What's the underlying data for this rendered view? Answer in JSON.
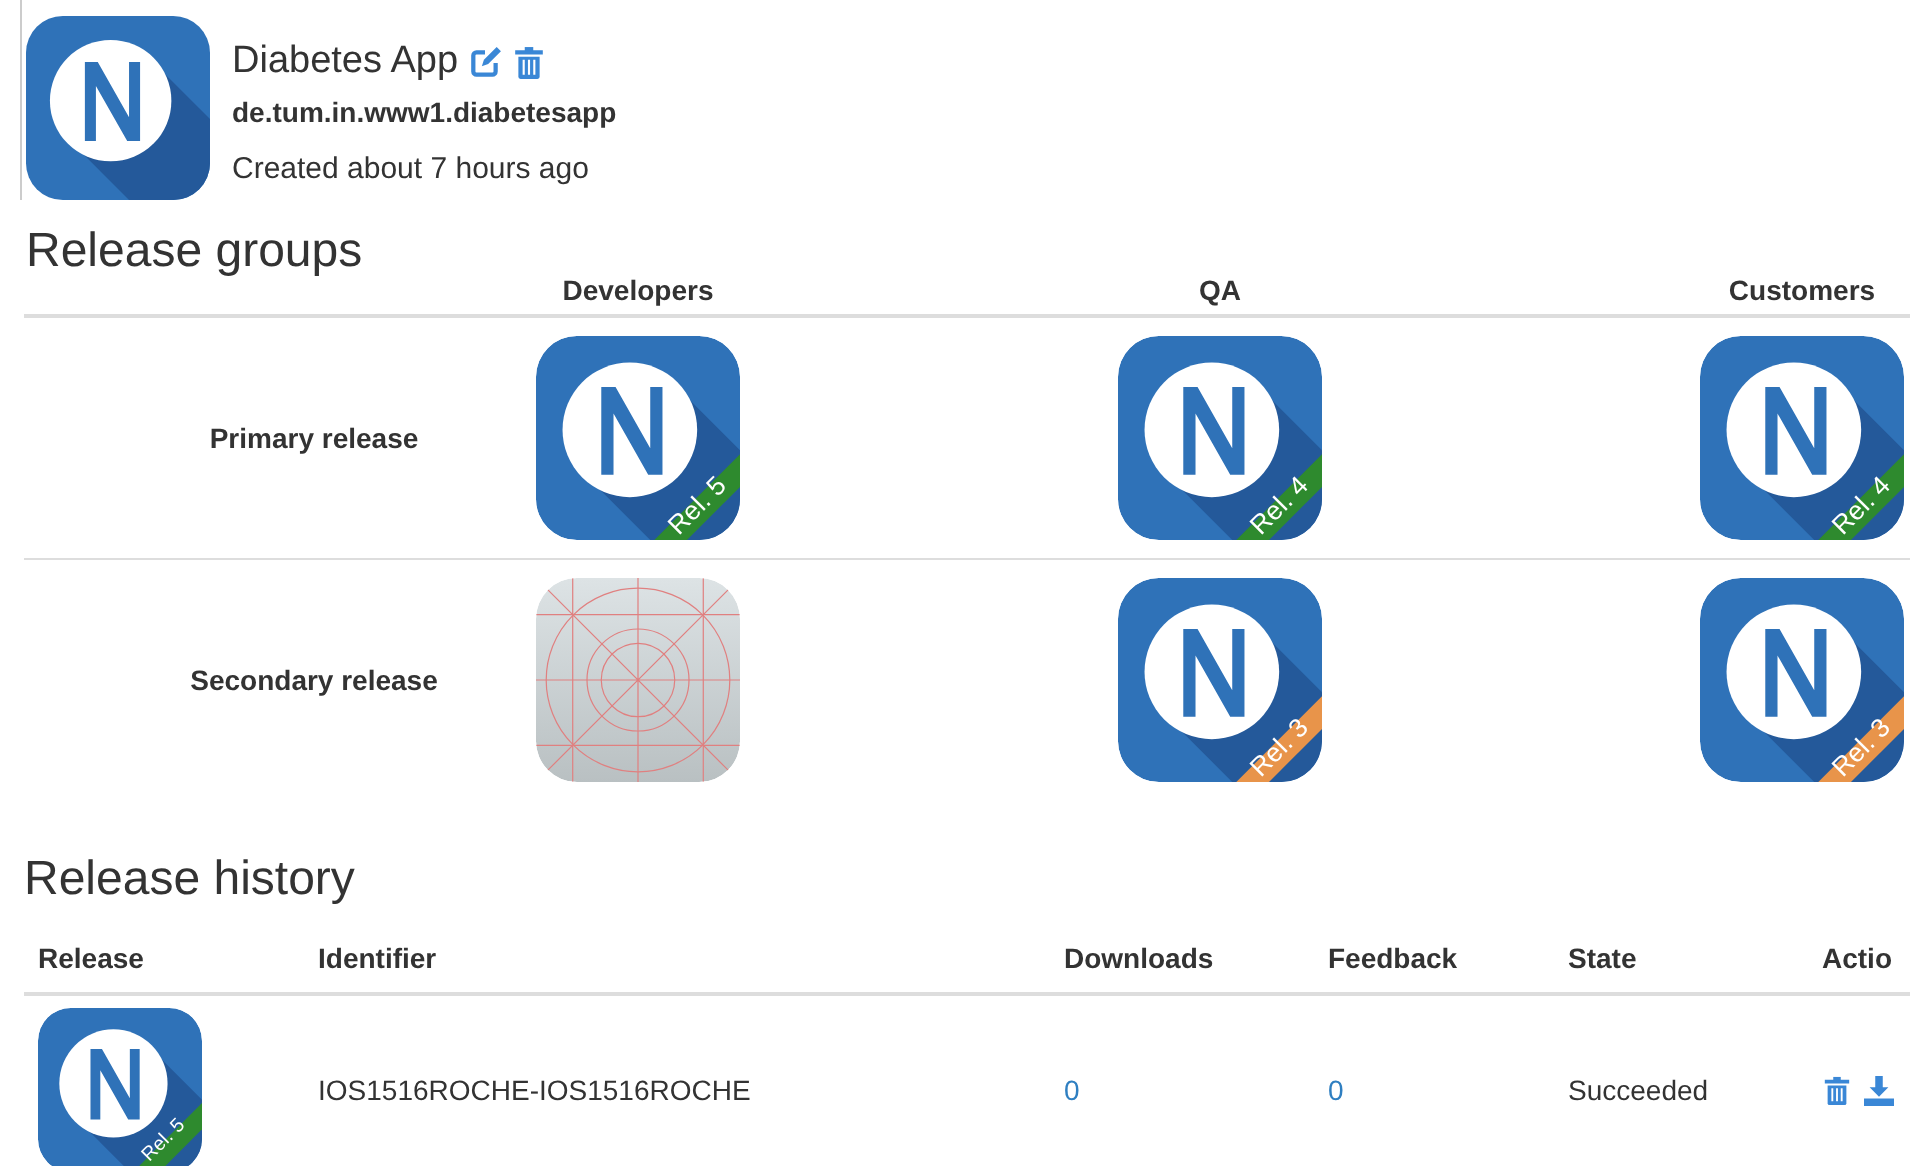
{
  "app": {
    "title": "Diabetes App",
    "package": "de.tum.in.www1.diabetesapp",
    "created": "Created about 7 hours ago"
  },
  "release_groups": {
    "title": "Release groups",
    "columns": [
      "Developers",
      "QA",
      "Customers"
    ],
    "rows": [
      {
        "label": "Primary release",
        "cells": [
          {
            "kind": "app_icon",
            "badge": "Rel. 5",
            "color": "#2e8a2e"
          },
          {
            "kind": "app_icon",
            "badge": "Rel. 4",
            "color": "#2e8a2e"
          },
          {
            "kind": "app_icon",
            "badge": "Rel. 4",
            "color": "#2e8a2e"
          }
        ]
      },
      {
        "label": "Secondary release",
        "cells": [
          {
            "kind": "placeholder"
          },
          {
            "kind": "app_icon",
            "badge": "Rel. 3",
            "color": "#e8944a"
          },
          {
            "kind": "app_icon",
            "badge": "Rel. 3",
            "color": "#e8944a"
          }
        ]
      }
    ]
  },
  "release_history": {
    "title": "Release history",
    "columns": [
      "Release",
      "Identifier",
      "Downloads",
      "Feedback",
      "State",
      "Actio"
    ],
    "rows": [
      {
        "badge": "Rel. 5",
        "color": "#2e8a2e",
        "identifier": "IOS1516ROCHE-IOS1516ROCHE",
        "downloads": "0",
        "feedback": "0",
        "state": "Succeeded"
      }
    ]
  }
}
